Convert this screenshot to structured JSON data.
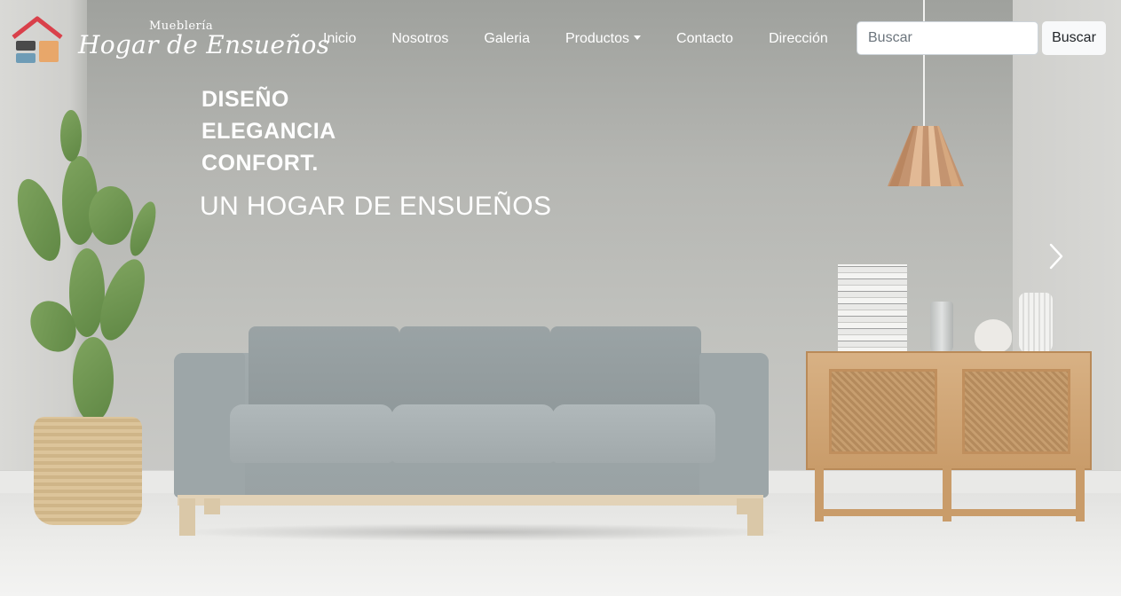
{
  "brand": {
    "small": "Mueblería",
    "name": "Hogar de Ensueños"
  },
  "nav": {
    "items": [
      {
        "label": "Inicio"
      },
      {
        "label": "Nosotros"
      },
      {
        "label": "Galeria"
      },
      {
        "label": "Productos",
        "dropdown": true
      },
      {
        "label": "Contacto"
      },
      {
        "label": "Dirección"
      }
    ]
  },
  "search": {
    "placeholder": "Buscar",
    "button_label": "Buscar"
  },
  "hero": {
    "lines": [
      "DISEÑO",
      "ELEGANCIA",
      "CONFORT."
    ],
    "headline": "UN HOGAR DE ENSUEÑOS"
  },
  "carousel": {
    "next_icon": "chevron-right-icon"
  },
  "colors": {
    "logo_roof": "#d9404a",
    "logo_dark": "#4a4a4a",
    "logo_blue": "#6e9cb6",
    "logo_orange": "#e8a76a"
  }
}
